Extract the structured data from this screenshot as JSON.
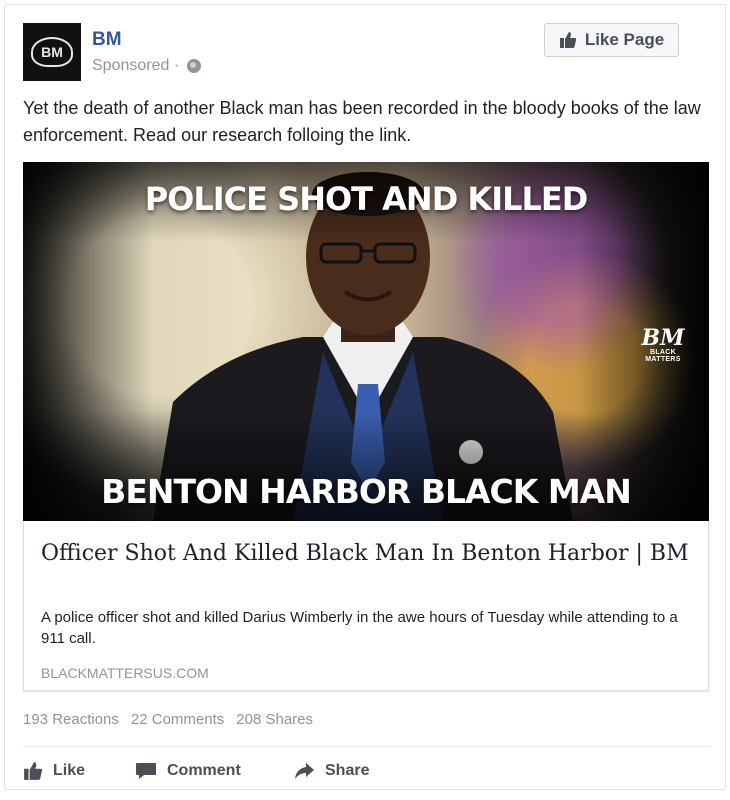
{
  "post": {
    "page_name": "BM",
    "avatar_text": "BM",
    "sponsored_label": "Sponsored ·",
    "like_page_label": "Like Page",
    "text": "Yet the death of another Black man has been recorded in the bloody books of the law enforcement. Read our research folloing the link."
  },
  "image": {
    "headline_top": "POLICE SHOT AND KILLED",
    "headline_bottom": "BENTON HARBOR BLACK MAN",
    "watermark_logo": "BM",
    "watermark_sub": "BLACK MATTERS"
  },
  "link_preview": {
    "title": "Officer Shot And Killed Black Man In Benton Harbor | BM",
    "description": "A police officer shot and killed Darius Wimberly in the awe hours of Tuesday while attending to a 911 call.",
    "domain": "BLACKMATTERSUS.COM"
  },
  "stats": {
    "reactions": "193 Reactions",
    "comments": "22 Comments",
    "shares": "208 Shares"
  },
  "actions": {
    "like": "Like",
    "comment": "Comment",
    "share": "Share"
  },
  "icons": {
    "like_page": "thumbs-up-icon",
    "privacy": "globe-icon",
    "like": "thumbs-up-icon",
    "comment": "speech-bubble-icon",
    "share": "share-arrow-icon"
  },
  "colors": {
    "page_name": "#365899",
    "muted_text": "#90949c",
    "action_text": "#4b4f56",
    "border": "#dddfe2"
  }
}
